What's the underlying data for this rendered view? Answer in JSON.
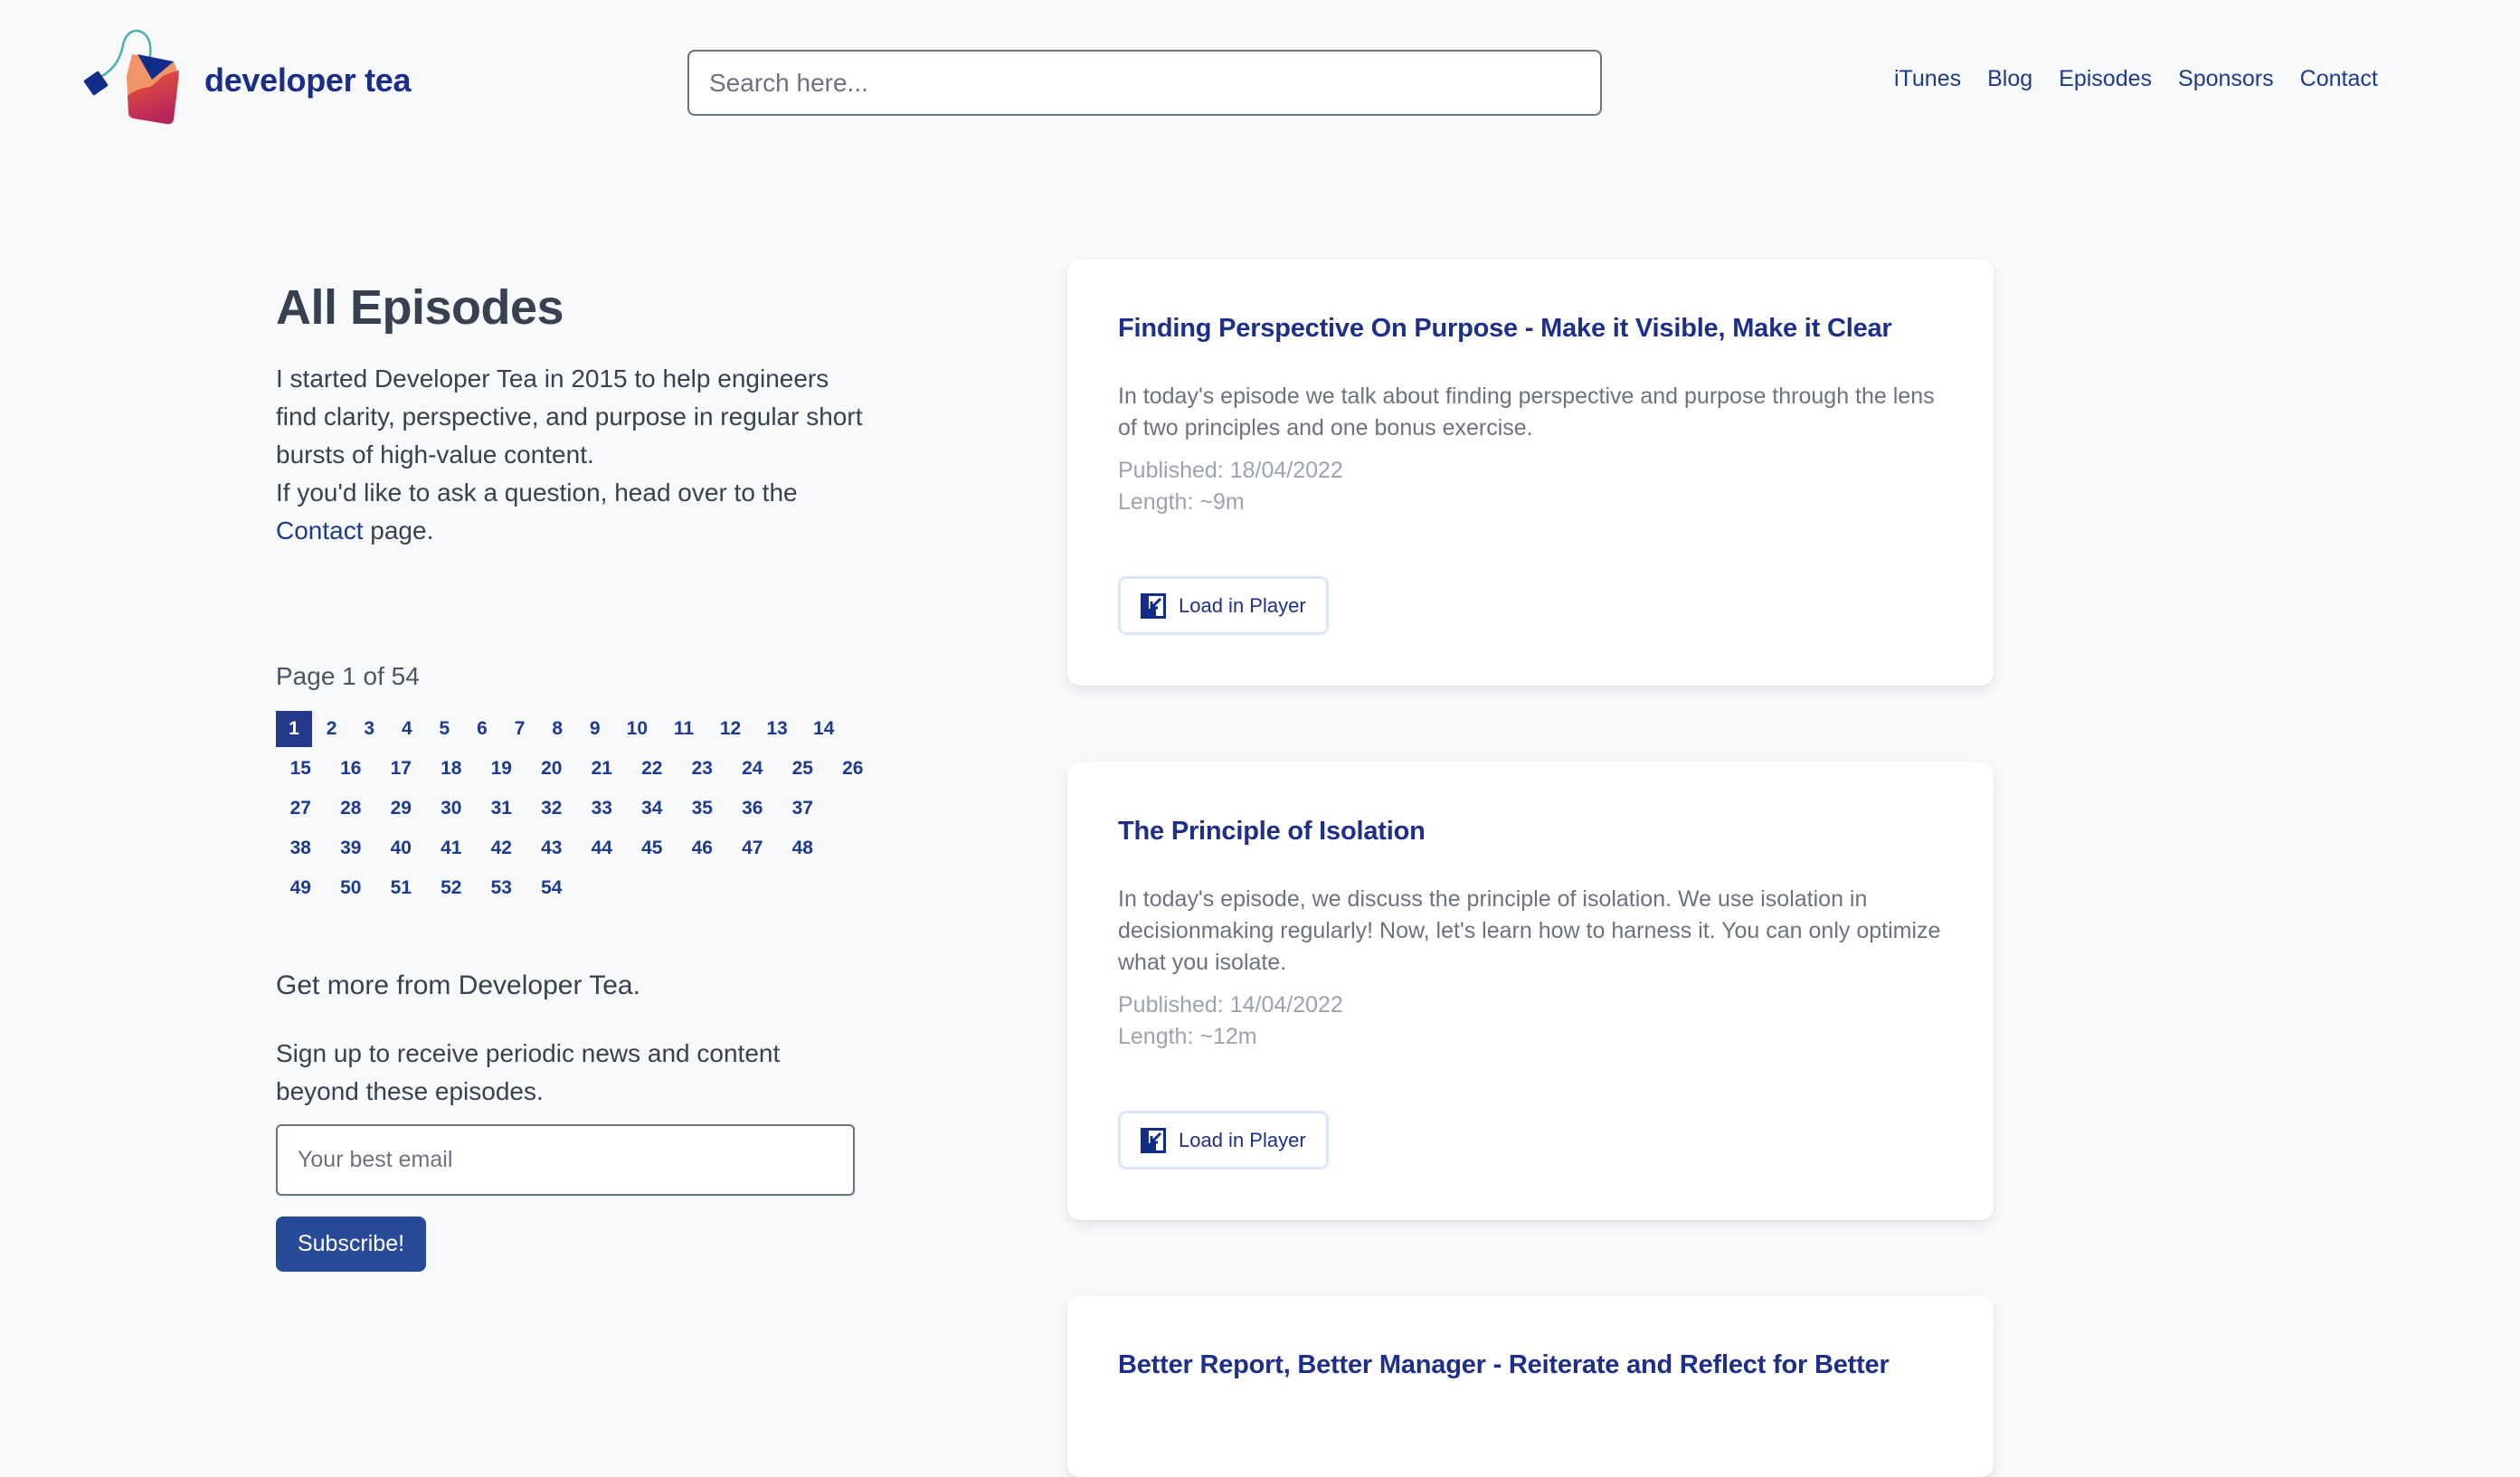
{
  "header": {
    "brand": "developer tea",
    "logo_icon": "tea-bag-logo-icon",
    "search_placeholder": "Search here...",
    "search_value": "",
    "nav": [
      {
        "label": "iTunes"
      },
      {
        "label": "Blog"
      },
      {
        "label": "Episodes"
      },
      {
        "label": "Sponsors"
      },
      {
        "label": "Contact"
      }
    ]
  },
  "intro": {
    "title": "All Episodes",
    "paragraph_1": "I started Developer Tea in 2015 to help engineers find clarity, perspective, and purpose in regular short bursts of high-value content.",
    "paragraph_2_prefix": "If you'd like to ask a question, head over to the",
    "contact_link": "Contact",
    "paragraph_2_suffix": "page."
  },
  "pagination": {
    "label": "Page 1 of 54",
    "current_page": 1,
    "total_pages": 54,
    "rows": [
      [
        "1",
        "2",
        "3",
        "4",
        "5",
        "6",
        "7",
        "8",
        "9",
        "10",
        "11",
        "12",
        "13",
        "14"
      ],
      [
        "15",
        "16",
        "17",
        "18",
        "19",
        "20",
        "21",
        "22",
        "23",
        "24",
        "25",
        "26"
      ],
      [
        "27",
        "28",
        "29",
        "30",
        "31",
        "32",
        "33",
        "34",
        "35",
        "36",
        "37"
      ],
      [
        "38",
        "39",
        "40",
        "41",
        "42",
        "43",
        "44",
        "45",
        "46",
        "47",
        "48"
      ],
      [
        "49",
        "50",
        "51",
        "52",
        "53",
        "54"
      ]
    ]
  },
  "newsletter": {
    "title": "Get more from Developer Tea.",
    "text": "Sign up to receive periodic news and content beyond these episodes.",
    "email_placeholder": "Your best email",
    "email_value": "",
    "button_label": "Subscribe!"
  },
  "episodes": [
    {
      "title": "Finding Perspective On Purpose - Make it Visible, Make it Clear",
      "description": "In today's episode we talk about finding perspective and purpose through the lens of two principles and one bonus exercise.",
      "published": "Published: 18/04/2022",
      "length": "Length: ~9m",
      "button_label": "Load in Player",
      "button_icon": "load-in-player-icon"
    },
    {
      "title": "The Principle of Isolation",
      "description": "In today's episode, we discuss the principle of isolation. We use isolation in decisionmaking regularly! Now, let's learn how to harness it. You can only optimize what you isolate.",
      "published": "Published: 14/04/2022",
      "length": "Length: ~12m",
      "button_label": "Load in Player",
      "button_icon": "load-in-player-icon"
    },
    {
      "title": "Better Report, Better Manager - Reiterate and Reflect for Better"
    }
  ],
  "colors": {
    "background": "#f8f9fb",
    "brand_navy": "#1a2e87",
    "link": "#1e3a8a",
    "active_page": "#24398a",
    "subscribe_button": "#284b97",
    "heading_text": "#374151",
    "muted_text": "#6b7280",
    "meta_text": "#9ca3af",
    "logo_orange": "#f0956a",
    "logo_red": "#e2553a",
    "logo_magenta": "#b8245e",
    "logo_string": "#4fb0b3"
  }
}
